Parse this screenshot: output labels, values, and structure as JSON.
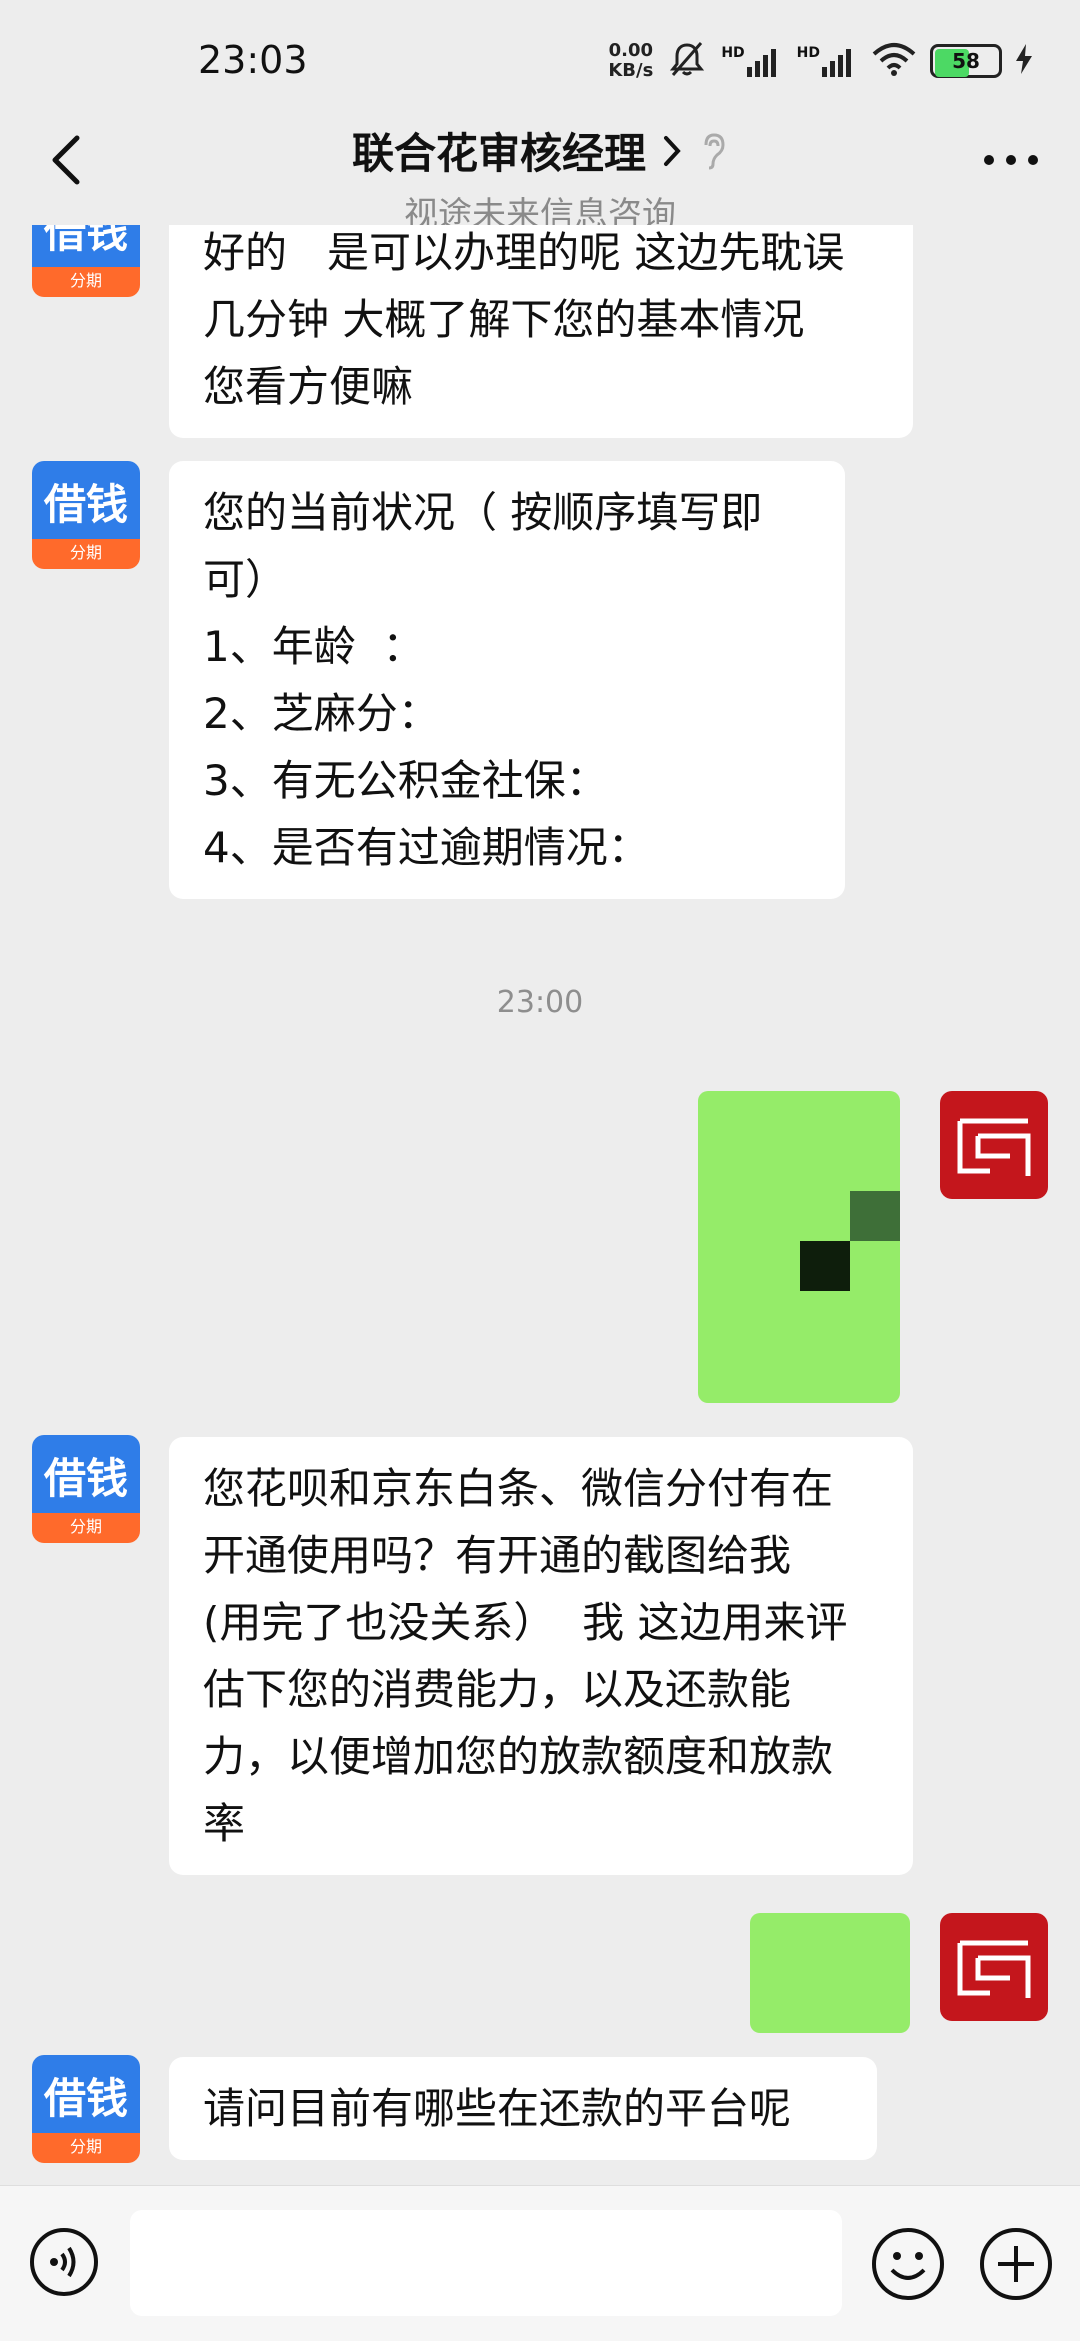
{
  "status_bar": {
    "time": "23:03",
    "net_speed_value": "0.00",
    "net_speed_unit": "KB/s",
    "signal_1_label": "HD",
    "signal_2_label": "HD",
    "battery_percent": "58",
    "battery_level_fraction": 0.58,
    "icons": [
      "mute-icon",
      "signal-icon",
      "signal-icon",
      "wifi-icon",
      "battery-icon",
      "charging-icon"
    ]
  },
  "header": {
    "title": "联合花审核经理",
    "subtitle": "视途未来信息咨询",
    "icons": [
      "back-chevron-icon",
      "chevron-right-icon",
      "ear-icon",
      "more-icon"
    ]
  },
  "messages": [
    {
      "side": "left",
      "avatar_text": "借钱",
      "avatar_sub": "分期",
      "text": "好的   是可以办理的呢 这边先耽误\n几分钟 大概了解下您的基本情况\n您看方便嘛"
    },
    {
      "side": "left",
      "avatar_text": "借钱",
      "avatar_sub": "分期",
      "text": "您的当前状况（ 按顺序填写即\n可）\n1、年龄  ：\n2、芝麻分：\n3、有无公积金社保：\n4、是否有过逾期情况："
    },
    {
      "type": "timestamp",
      "text": "23:00"
    },
    {
      "side": "right",
      "type": "redacted",
      "content": "blurred"
    },
    {
      "side": "left",
      "avatar_text": "借钱",
      "avatar_sub": "分期",
      "text": "您花呗和京东白条、微信分付有在\n开通使用吗？有开通的截图给我\n(用完了也没关系）  我 这边用来评\n估下您的消费能力，以及还款能\n力，以便增加您的放款额度和放款\n率"
    },
    {
      "side": "right",
      "type": "redacted",
      "content": "blurred"
    },
    {
      "side": "left",
      "avatar_text": "借钱",
      "avatar_sub": "分期",
      "text": "请问目前有哪些在还款的平台呢"
    }
  ],
  "colors": {
    "background": "#ededed",
    "bubble_left": "#ffffff",
    "bubble_right": "#95ec69",
    "avatar_blue": "#2f7de8",
    "avatar_orange": "#ff6a2b",
    "avatar_red": "#c4161c"
  },
  "input_bar": {
    "placeholder": "",
    "icons": [
      "voice-icon",
      "emoji-icon",
      "plus-icon"
    ]
  }
}
